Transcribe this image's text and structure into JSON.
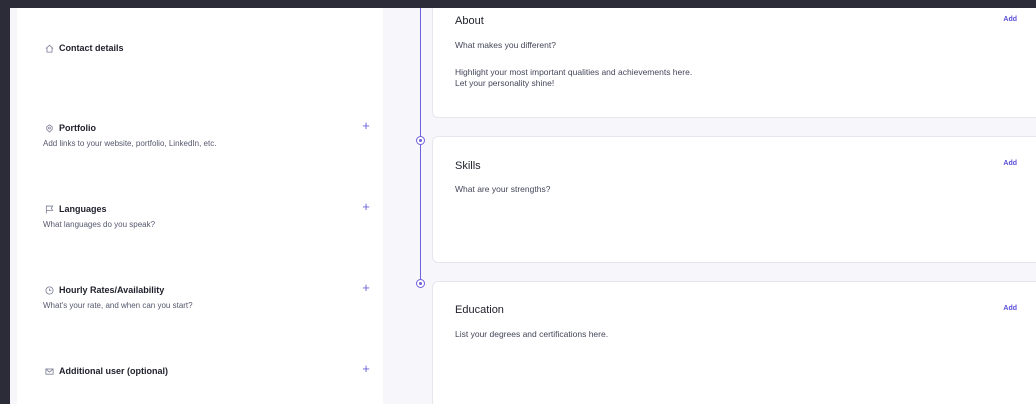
{
  "left_panel": {
    "contact": {
      "title": "Contact details",
      "icon": "home-icon"
    },
    "portfolio": {
      "title": "Portfolio",
      "icon": "link-icon",
      "desc": "Add links to your website, portfolio, LinkedIn, etc.",
      "add": "+"
    },
    "languages": {
      "title": "Languages",
      "icon": "flag-icon",
      "desc": "What languages do you speak?",
      "add": "+"
    },
    "rates": {
      "title": "Hourly Rates/Availability",
      "icon": "clock-icon",
      "desc": "What's your rate, and when can you start?",
      "add": "+"
    },
    "additional_user": {
      "title": "Additional user (optional)",
      "icon": "mail-icon",
      "add": "+"
    }
  },
  "cards": {
    "about": {
      "title": "About",
      "add": "Add",
      "subtitle": "What makes you different?",
      "line1": "Highlight your most important qualities and achievements here.",
      "line2": "Let your personality shine!"
    },
    "skills": {
      "title": "Skills",
      "add": "Add",
      "subtitle": "What are your strengths?"
    },
    "education": {
      "title": "Education",
      "add": "Add",
      "subtitle": "List your degrees and certifications here."
    }
  },
  "colors": {
    "accent": "#6b61d8",
    "frame": "#2b2c38",
    "background": "#f7f7fb"
  }
}
